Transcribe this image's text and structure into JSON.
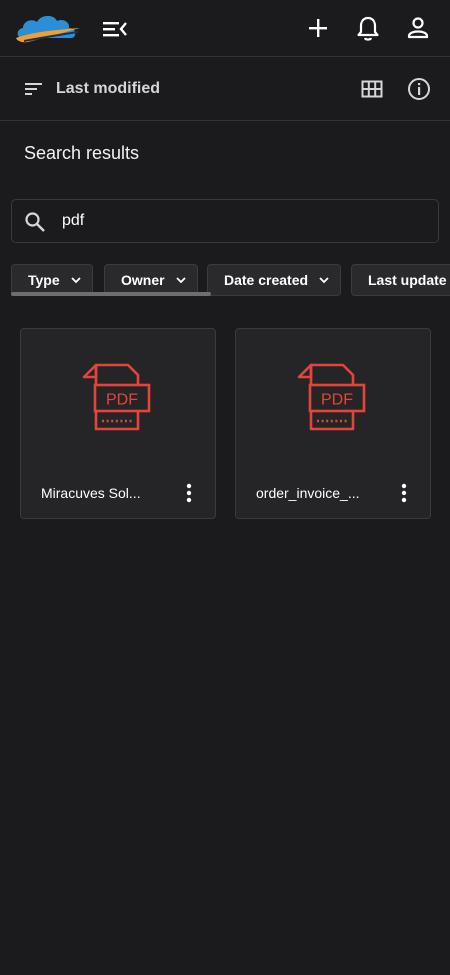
{
  "header": {
    "logo_icon": "cloud-logo-icon",
    "menu_icon": "menu-collapse-icon",
    "add_icon": "plus-icon",
    "notifications_icon": "bell-icon",
    "account_icon": "user-icon"
  },
  "sortbar": {
    "sort_label": "Last modified",
    "sort_icon": "sort-lines-icon",
    "view_icon": "grid-view-icon",
    "info_icon": "info-icon"
  },
  "main": {
    "title": "Search results",
    "search": {
      "value": "pdf",
      "icon": "search-icon"
    },
    "filters": [
      {
        "label": "Type"
      },
      {
        "label": "Owner"
      },
      {
        "label": "Date created"
      },
      {
        "label": "Last update"
      }
    ],
    "files": [
      {
        "name": "Miracuves Sol...",
        "icon": "pdf-file-icon"
      },
      {
        "name": "order_invoice_...",
        "icon": "pdf-file-icon"
      }
    ],
    "pdf_badge_text": "PDF"
  },
  "colors": {
    "background": "#1b1b1d",
    "card": "#252528",
    "pdf_red": "#e5443b",
    "logo_blue": "#2b8fd8",
    "logo_orange": "#f0a030"
  }
}
